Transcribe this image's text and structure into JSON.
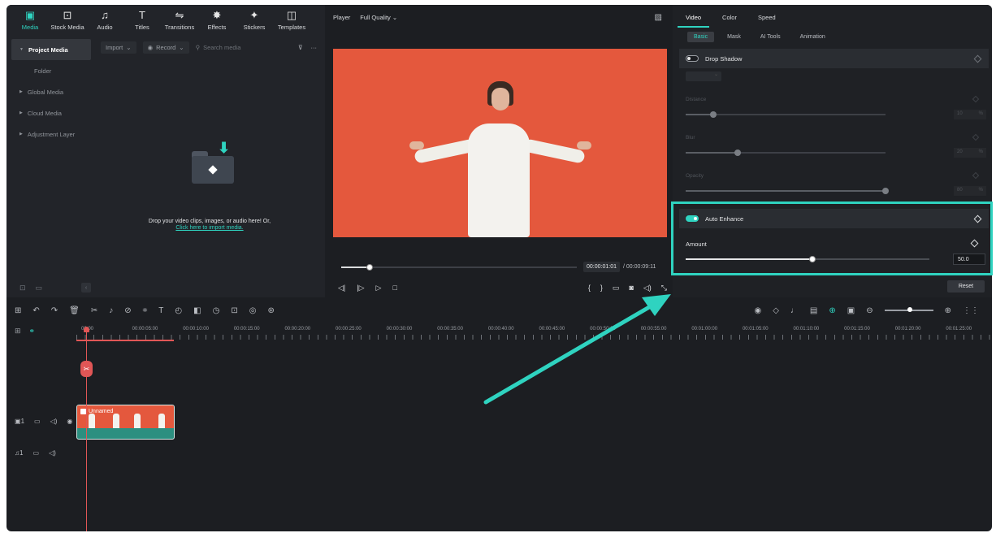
{
  "nav": {
    "items": [
      {
        "label": "Media",
        "glyph": "▣",
        "active": true
      },
      {
        "label": "Stock Media",
        "glyph": "⊡"
      },
      {
        "label": "Audio",
        "glyph": "♫"
      },
      {
        "label": "Titles",
        "glyph": "T"
      },
      {
        "label": "Transitions",
        "glyph": "⇋"
      },
      {
        "label": "Effects",
        "glyph": "✸"
      },
      {
        "label": "Stickers",
        "glyph": "✦"
      },
      {
        "label": "Templates",
        "glyph": "◫"
      }
    ]
  },
  "sidebar": {
    "items": [
      {
        "label": "Project Media",
        "arrow": "▼"
      },
      {
        "label": "Folder"
      },
      {
        "label": "Global Media",
        "arrow": "▶"
      },
      {
        "label": "Cloud Media",
        "arrow": "▶"
      },
      {
        "label": "Adjustment Layer",
        "arrow": "▶"
      }
    ],
    "footer_icons": [
      "new-folder-icon",
      "folder-icon",
      "collapse-icon"
    ]
  },
  "media_toolbar": {
    "import_label": "Import",
    "record_label": "Record",
    "search_placeholder": "Search media"
  },
  "drop_area": {
    "message": "Drop your video clips, images, or audio here! Or,",
    "link": "Click here to import media."
  },
  "player": {
    "title": "Player",
    "quality": "Full Quality",
    "current_time": "00:00:01:01",
    "total_time": "/ 00:00:09:11",
    "progress": 0.12
  },
  "props": {
    "tabs": [
      "Video",
      "Color",
      "Speed"
    ],
    "sub_tabs": [
      "Basic",
      "Mask",
      "AI Tools",
      "Animation"
    ],
    "drop_shadow": {
      "label": "Drop Shadow",
      "distance_label": "Distance",
      "distance_value": "10",
      "distance_unit": "%",
      "distance_level": 0.14,
      "blur_label": "Blur",
      "blur_value": "20",
      "blur_unit": "%",
      "blur_level": 0.26,
      "opacity_label": "Opacity",
      "opacity_value": "80",
      "opacity_unit": "%",
      "opacity_level": 1.0
    },
    "auto_enhance": {
      "label": "Auto Enhance",
      "amount_label": "Amount",
      "amount_value": "50.0",
      "amount_level": 0.52
    },
    "reset_label": "Reset"
  },
  "timeline": {
    "ruler_labels": [
      "00:00",
      "00:00:05:00",
      "00:00:10:00",
      "00:00:15:00",
      "00:00:20:00",
      "00:00:25:00",
      "00:00:30:00",
      "00:00:35:00",
      "00:00:40:00",
      "00:00:45:00",
      "00:00:50:00",
      "00:00:55:00",
      "00:01:00:00",
      "00:01:05:00",
      "00:01:10:00",
      "00:01:15:00",
      "00:01:20:00",
      "00:01:25:00"
    ],
    "clip_name": "Unnamed",
    "video_track_num": "1",
    "audio_track_num": "1"
  },
  "colors": {
    "accent": "#2fd3c0",
    "playhead": "#e05656",
    "video_bg": "#e4583d"
  }
}
